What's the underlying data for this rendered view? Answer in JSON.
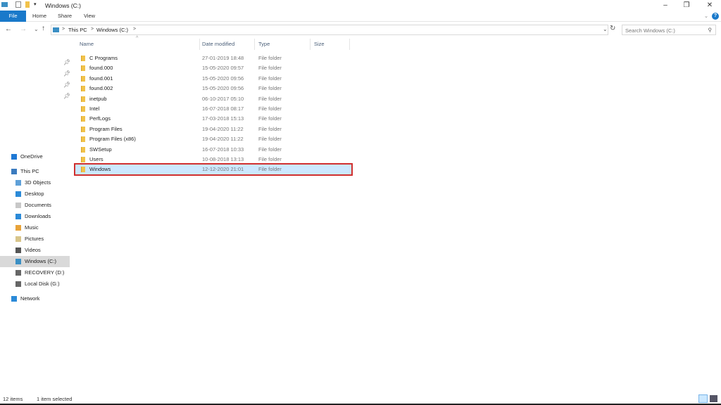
{
  "window": {
    "title": "Windows (C:)",
    "minimize": "–",
    "restore": "❐",
    "close": "✕"
  },
  "ribbon": {
    "tabs": [
      "File",
      "Home",
      "Share",
      "View"
    ],
    "help": "?",
    "expand": "⌄"
  },
  "address": {
    "back": "←",
    "forward": "→",
    "recent": "⌄",
    "up": "↑",
    "crumbs": [
      "This PC",
      "Windows (C:)"
    ],
    "sep": ">",
    "dropdown": "⌄",
    "refresh": "↻"
  },
  "search": {
    "placeholder": "Search Windows (C:)",
    "icon": "⚲"
  },
  "columns": {
    "name": "Name",
    "date": "Date modified",
    "type": "Type",
    "size": "Size",
    "sort": "^"
  },
  "files": [
    {
      "name": "C Programs",
      "date": "27-01-2019 18:48",
      "type": "File folder"
    },
    {
      "name": "found.000",
      "date": "15-05-2020 09:57",
      "type": "File folder"
    },
    {
      "name": "found.001",
      "date": "15-05-2020 09:56",
      "type": "File folder"
    },
    {
      "name": "found.002",
      "date": "15-05-2020 09:56",
      "type": "File folder"
    },
    {
      "name": "inetpub",
      "date": "06-10-2017 05:10",
      "type": "File folder"
    },
    {
      "name": "Intel",
      "date": "16-07-2018 08:17",
      "type": "File folder"
    },
    {
      "name": "PerfLogs",
      "date": "17-03-2018 15:13",
      "type": "File folder"
    },
    {
      "name": "Program Files",
      "date": "19-04-2020 11:22",
      "type": "File folder"
    },
    {
      "name": "Program Files (x86)",
      "date": "19-04-2020 11:22",
      "type": "File folder"
    },
    {
      "name": "SWSetup",
      "date": "16-07-2018 10:33",
      "type": "File folder"
    },
    {
      "name": "Users",
      "date": "10-08-2018 13:13",
      "type": "File folder"
    },
    {
      "name": "Windows",
      "date": "12-12-2020 21:01",
      "type": "File folder",
      "selected": true
    }
  ],
  "nav": [
    {
      "label": "OneDrive",
      "color": "#1e78d4"
    },
    {
      "label": "This PC",
      "color": "#3b7bbf"
    },
    {
      "label": "3D Objects",
      "color": "#5fa0d8"
    },
    {
      "label": "Desktop",
      "color": "#2b8ad8"
    },
    {
      "label": "Documents",
      "color": "#c8c8c8"
    },
    {
      "label": "Downloads",
      "color": "#2b8ad8"
    },
    {
      "label": "Music",
      "color": "#e8a33a"
    },
    {
      "label": "Pictures",
      "color": "#d8c58a"
    },
    {
      "label": "Videos",
      "color": "#555555"
    },
    {
      "label": "Windows (C:)",
      "color": "#3b8fc4",
      "selected": true
    },
    {
      "label": "RECOVERY (D:)",
      "color": "#666666"
    },
    {
      "label": "Local Disk (G:)",
      "color": "#666666"
    },
    {
      "label": "Network",
      "color": "#2b8ad8"
    }
  ],
  "status": {
    "count": "12 items",
    "selected": "1 item selected"
  },
  "colors": {
    "accent": "#1979ca",
    "selection": "#cce8ff",
    "highlight_box": "#d0302f"
  }
}
